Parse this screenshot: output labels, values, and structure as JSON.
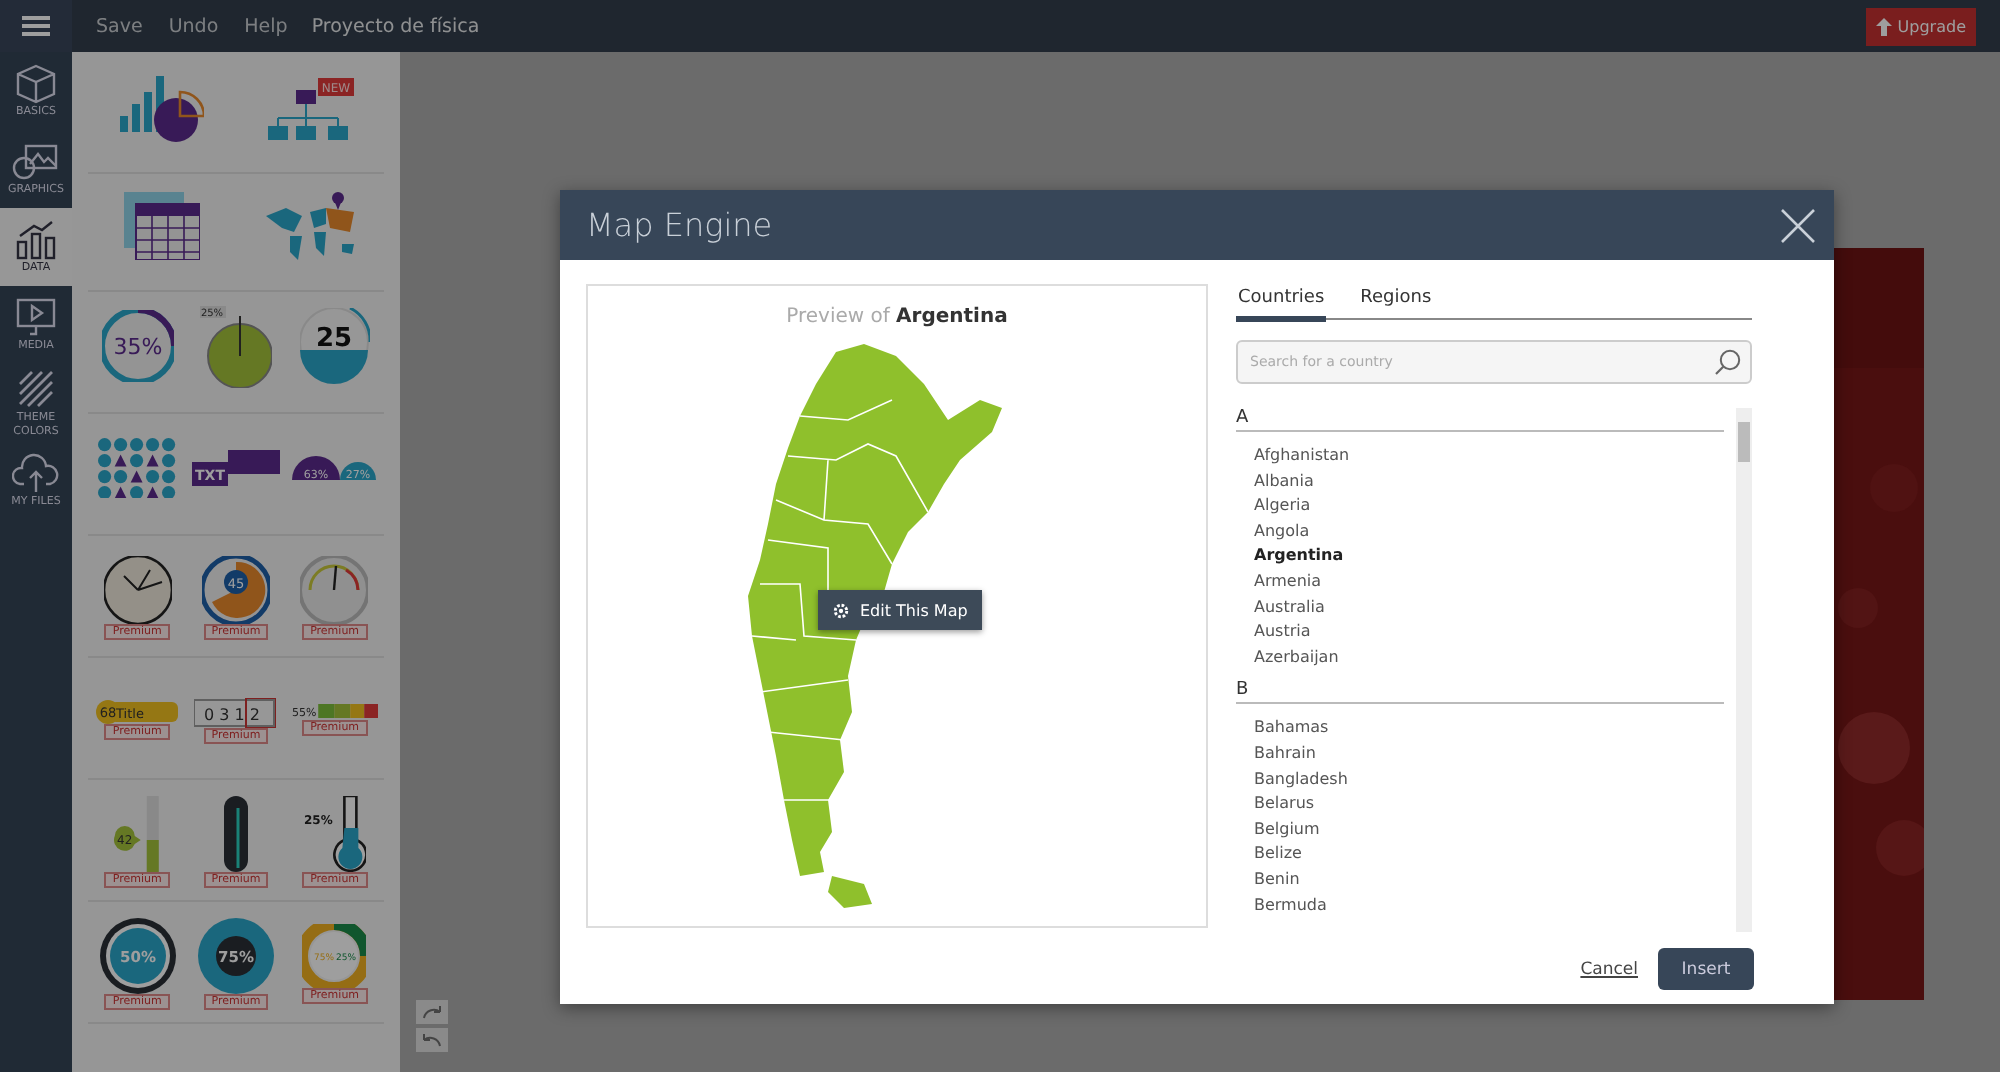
{
  "top_bar": {
    "menu_items": [
      "Save",
      "Undo",
      "Help"
    ],
    "project_title": "Proyecto de física",
    "upgrade_button": "Upgrade"
  },
  "rail": [
    {
      "kind": "basics",
      "label": "BASICS",
      "selected": false
    },
    {
      "kind": "graphics",
      "label": "GRAPHICS",
      "selected": false
    },
    {
      "kind": "data",
      "label": "DATA",
      "selected": true
    },
    {
      "kind": "media",
      "label": "MEDIA",
      "selected": false
    },
    {
      "kind": "theme",
      "label": "THEME COLORS",
      "selected": false
    },
    {
      "kind": "files",
      "label": "MY FILES",
      "selected": false
    }
  ],
  "panel": {
    "rows": [
      {
        "tiles": [
          {
            "kind": "bar-pie"
          },
          {
            "kind": "org-chart",
            "texts": [
              "NEW"
            ]
          }
        ]
      },
      {
        "tiles": [
          {
            "kind": "table"
          },
          {
            "kind": "world-map"
          }
        ]
      },
      {
        "tiles": [
          {
            "kind": "ring",
            "texts": [
              "35%"
            ]
          },
          {
            "kind": "pie-gauge",
            "texts": [
              "25%"
            ]
          },
          {
            "kind": "number-dial",
            "texts": [
              "25"
            ]
          }
        ]
      },
      {
        "tiles": [
          {
            "kind": "shape-grid"
          },
          {
            "kind": "text-label",
            "texts": [
              "TXT"
            ]
          },
          {
            "kind": "half-gauges",
            "texts": [
              "63%",
              "27%"
            ]
          }
        ]
      },
      {
        "tiles": [
          {
            "kind": "clock",
            "premium": "Premium"
          },
          {
            "kind": "dial",
            "texts": [
              "45"
            ],
            "premium": "Premium"
          },
          {
            "kind": "speedometer",
            "premium": "Premium"
          }
        ]
      },
      {
        "tiles": [
          {
            "kind": "title-tag",
            "texts": [
              "68",
              "Title"
            ],
            "premium": "Premium"
          },
          {
            "kind": "counter",
            "texts": [
              "0 3 1 2"
            ],
            "premium": "Premium"
          },
          {
            "kind": "level-bar",
            "texts": [
              "55%"
            ],
            "premium": "Premium"
          }
        ]
      },
      {
        "tiles": [
          {
            "kind": "thermometer",
            "texts": [
              "42"
            ],
            "premium": "Premium"
          },
          {
            "kind": "tube",
            "premium": "Premium"
          },
          {
            "kind": "flask",
            "texts": [
              "25%"
            ],
            "premium": "Premium"
          }
        ]
      },
      {
        "tiles": [
          {
            "kind": "donut",
            "texts": [
              "50%"
            ],
            "premium": "Premium"
          },
          {
            "kind": "dark-donut",
            "texts": [
              "75%"
            ],
            "premium": "Premium"
          },
          {
            "kind": "split-donut",
            "texts": [
              "75%",
              "25%"
            ],
            "premium": "Premium"
          }
        ]
      }
    ]
  },
  "dialog": {
    "title": "Map Engine",
    "preview": {
      "caption": "Preview of **Argentina**",
      "edit_button": "Edit This Map"
    },
    "tabs": [
      {
        "label": "Countries",
        "selected": true
      },
      {
        "label": "Regions",
        "selected": false
      }
    ],
    "search": {
      "placeholder": "Search for a country"
    },
    "groups": [
      {
        "letter": "A",
        "countries": [
          {
            "name": "Afghanistan",
            "selected": false
          },
          {
            "name": "Albania",
            "selected": false
          },
          {
            "name": "Algeria",
            "selected": false
          },
          {
            "name": "Angola",
            "selected": false
          },
          {
            "name": "Argentina",
            "selected": true
          },
          {
            "name": "Armenia",
            "selected": false
          },
          {
            "name": "Australia",
            "selected": false
          },
          {
            "name": "Austria",
            "selected": false
          },
          {
            "name": "Azerbaijan",
            "selected": false
          }
        ]
      },
      {
        "letter": "B",
        "countries": [
          {
            "name": "Bahamas",
            "selected": false
          },
          {
            "name": "Bahrain",
            "selected": false
          },
          {
            "name": "Bangladesh",
            "selected": false
          },
          {
            "name": "Belarus",
            "selected": false
          },
          {
            "name": "Belgium",
            "selected": false
          },
          {
            "name": "Belize",
            "selected": false
          },
          {
            "name": "Benin",
            "selected": false
          },
          {
            "name": "Bermuda",
            "selected": false
          }
        ]
      }
    ],
    "cancel": "Cancel",
    "insert": "Insert"
  }
}
